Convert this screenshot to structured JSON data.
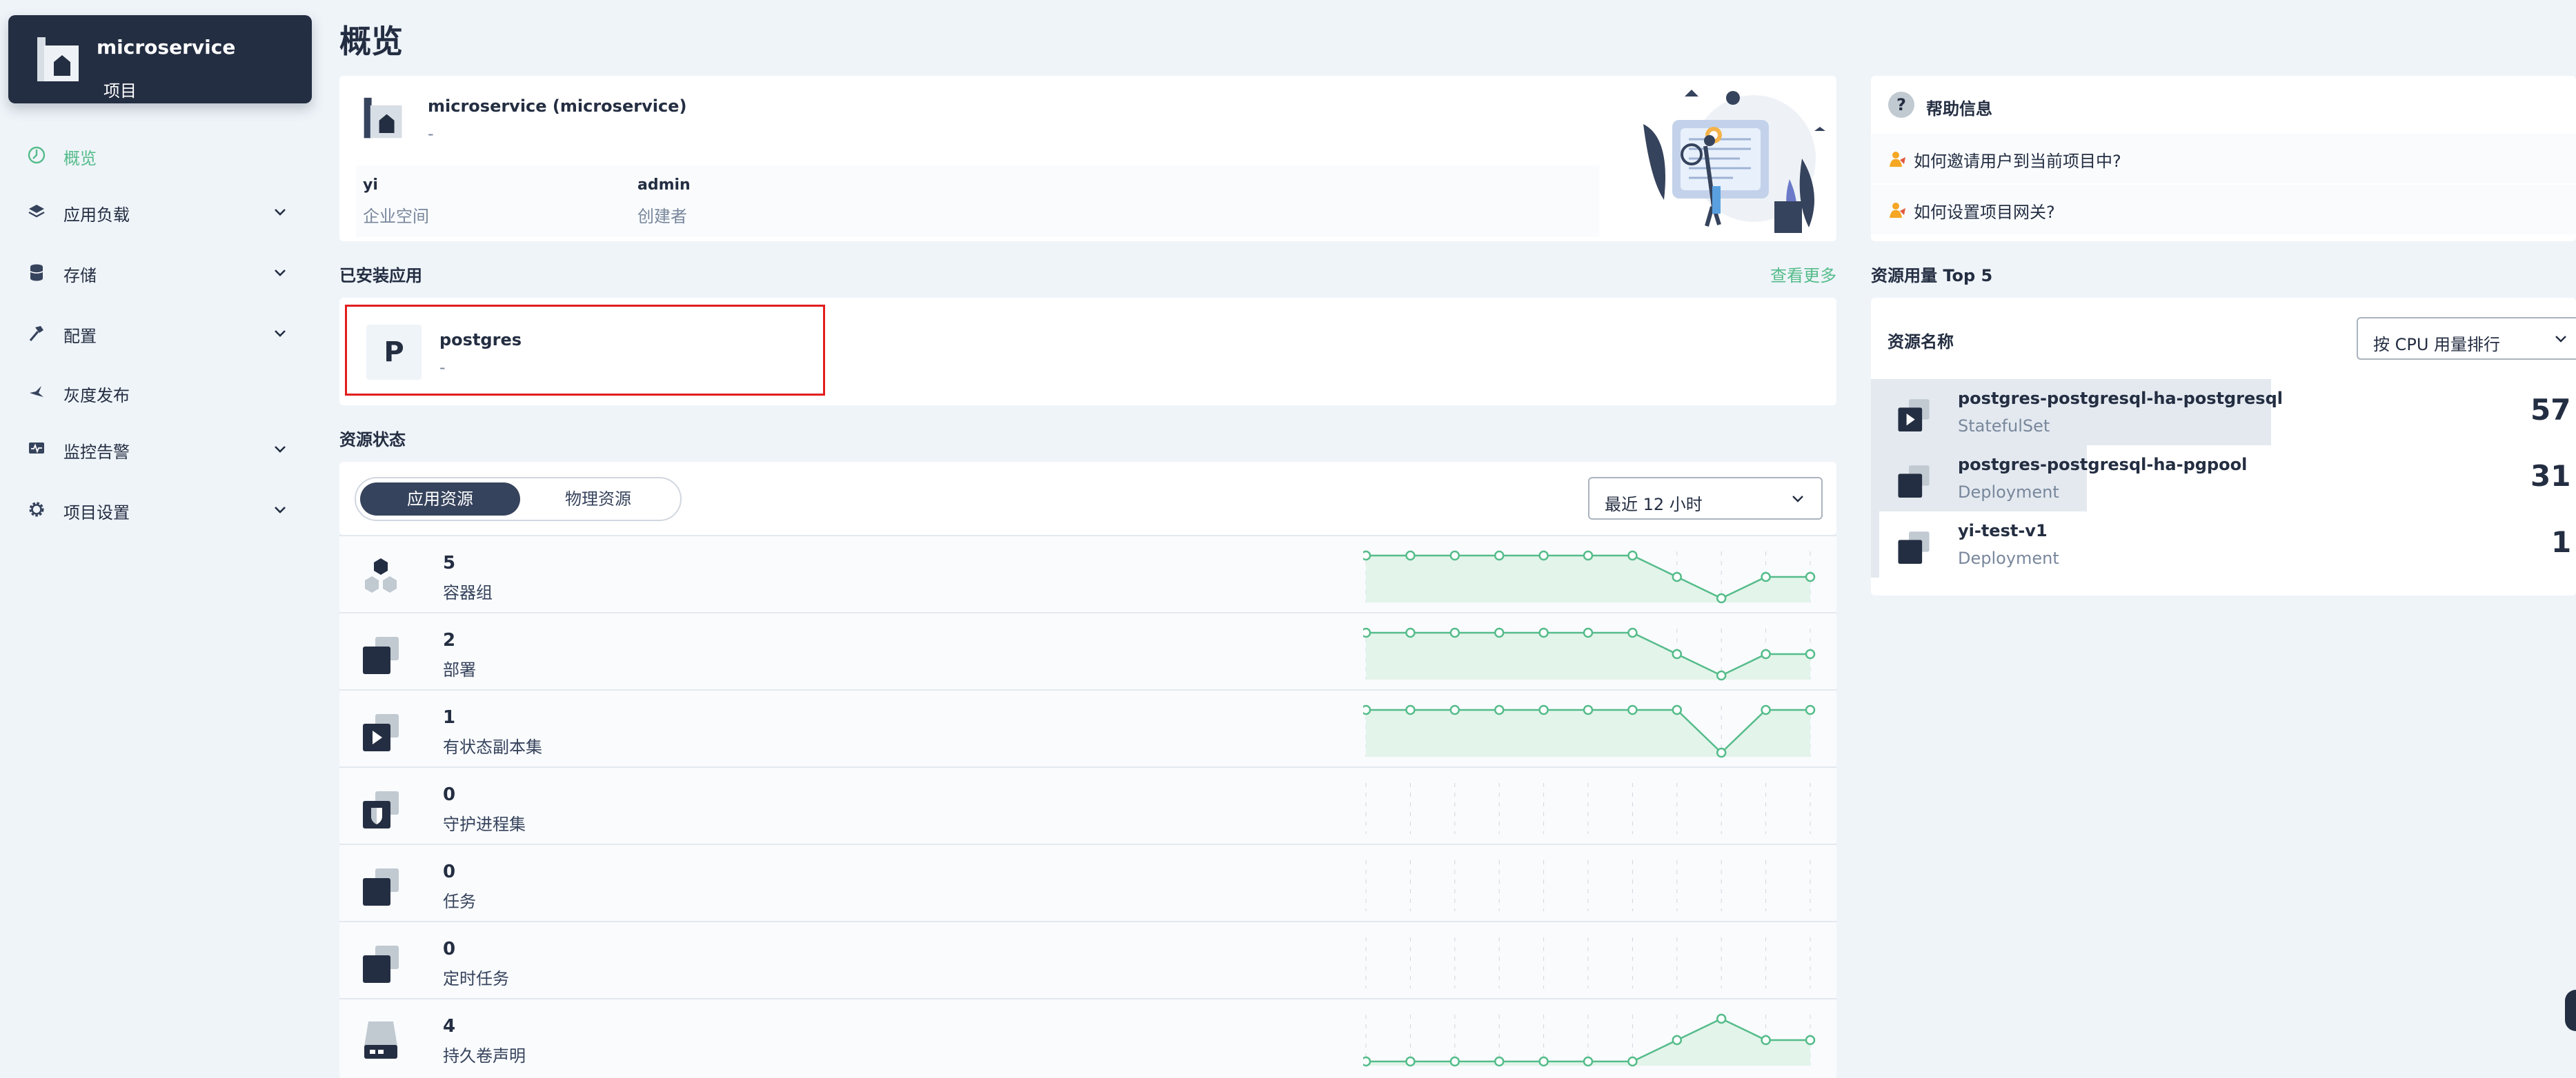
{
  "sidebar": {
    "project_name": "microservice",
    "project_type": "项目",
    "items": [
      {
        "label": "概览",
        "active": true,
        "expandable": false
      },
      {
        "label": "应用负载",
        "active": false,
        "expandable": true
      },
      {
        "label": "存储",
        "active": false,
        "expandable": true
      },
      {
        "label": "配置",
        "active": false,
        "expandable": true
      },
      {
        "label": "灰度发布",
        "active": false,
        "expandable": false
      },
      {
        "label": "监控告警",
        "active": false,
        "expandable": true
      },
      {
        "label": "项目设置",
        "active": false,
        "expandable": true
      }
    ]
  },
  "page": {
    "title": "概览"
  },
  "project_info": {
    "title": "microservice (microservice)",
    "desc": "-",
    "workspace_value": "yi",
    "workspace_label": "企业空间",
    "creator_value": "admin",
    "creator_label": "创建者"
  },
  "installed_apps": {
    "title": "已安装应用",
    "more": "查看更多",
    "apps": [
      {
        "letter": "P",
        "name": "postgres",
        "desc": "-"
      }
    ]
  },
  "resource_status": {
    "title": "资源状态",
    "tabs": [
      "应用资源",
      "物理资源"
    ],
    "time_range": "最近 12 小时",
    "rows": [
      {
        "count": "5",
        "name": "容器组",
        "icon": "pod-icon",
        "series": [
          5,
          5,
          5,
          5,
          5,
          5,
          5,
          4,
          3,
          4,
          4
        ]
      },
      {
        "count": "2",
        "name": "部署",
        "icon": "deployment-icon",
        "series": [
          2,
          2,
          2,
          2,
          2,
          2,
          2,
          1,
          0,
          1,
          1
        ]
      },
      {
        "count": "1",
        "name": "有状态副本集",
        "icon": "statefulset-icon",
        "series": [
          1,
          1,
          1,
          1,
          1,
          1,
          1,
          1,
          0,
          1,
          1
        ]
      },
      {
        "count": "0",
        "name": "守护进程集",
        "icon": "daemonset-icon",
        "series": []
      },
      {
        "count": "0",
        "name": "任务",
        "icon": "job-icon",
        "series": []
      },
      {
        "count": "0",
        "name": "定时任务",
        "icon": "cronjob-icon",
        "series": []
      },
      {
        "count": "4",
        "name": "持久卷声明",
        "icon": "pvc-icon",
        "series": [
          3,
          3,
          3,
          3,
          3,
          3,
          3,
          3.5,
          4,
          3.5,
          3.5
        ]
      }
    ]
  },
  "help": {
    "title": "帮助信息",
    "items": [
      "如何邀请用户到当前项目中?",
      "如何设置项目网关?"
    ]
  },
  "top5": {
    "title": "资源用量 Top 5",
    "header": "资源名称",
    "sort_label": "按 CPU 用量排行",
    "items": [
      {
        "name": "postgres-postgresql-ha-postgresql",
        "kind": "StatefulSet",
        "value": "57",
        "icon": "statefulset-icon",
        "bar": 1.0
      },
      {
        "name": "postgres-postgresql-ha-pgpool",
        "kind": "Deployment",
        "value": "31",
        "icon": "deployment-icon",
        "bar": 0.54
      },
      {
        "name": "yi-test-v1",
        "kind": "Deployment",
        "value": "1",
        "icon": "deployment-icon",
        "bar": 0.02
      }
    ]
  },
  "colors": {
    "accent": "#55bc8a",
    "dark": "#242e42",
    "highlight": "#e21d1d"
  }
}
